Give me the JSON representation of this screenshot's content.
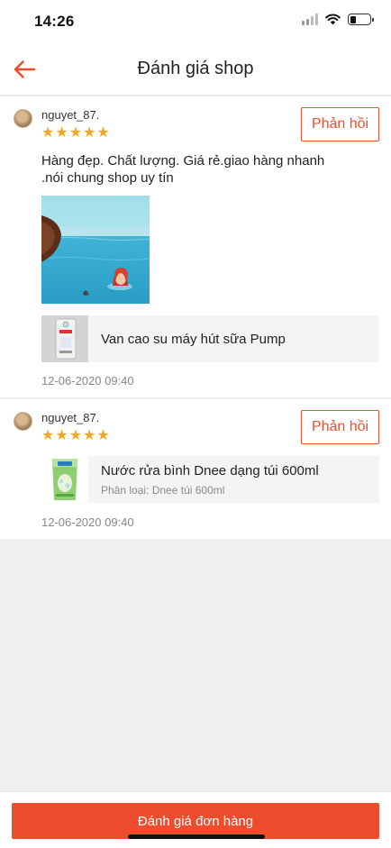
{
  "status_bar": {
    "time": "14:26",
    "battery_level": 0.3
  },
  "header": {
    "title": "Đánh giá shop",
    "back_icon": "arrow-left-icon"
  },
  "reviews": [
    {
      "username": "nguyet_87.",
      "rating": 5,
      "reply_label": "Phản hồi",
      "text_lines": [
        "Hàng đẹp. Chất lượng. Giá rẻ.giao hàng nhanh",
        ".nói chung shop uy tín"
      ],
      "has_photo": true,
      "product": {
        "name": "Van cao su máy hút sữa Pump",
        "variant": ""
      },
      "timestamp": "12-06-2020 09:40"
    },
    {
      "username": "nguyet_87.",
      "rating": 5,
      "reply_label": "Phản hồi",
      "product": {
        "name": "Nước rửa bình Dnee dạng túi 600ml",
        "variant": "Phân loại: Dnee túi 600ml"
      },
      "timestamp": "12-06-2020 09:40"
    }
  ],
  "footer": {
    "button_label": "Đánh giá đơn hàng"
  },
  "colors": {
    "accent": "#ee4d2d",
    "star": "#f5a623"
  }
}
